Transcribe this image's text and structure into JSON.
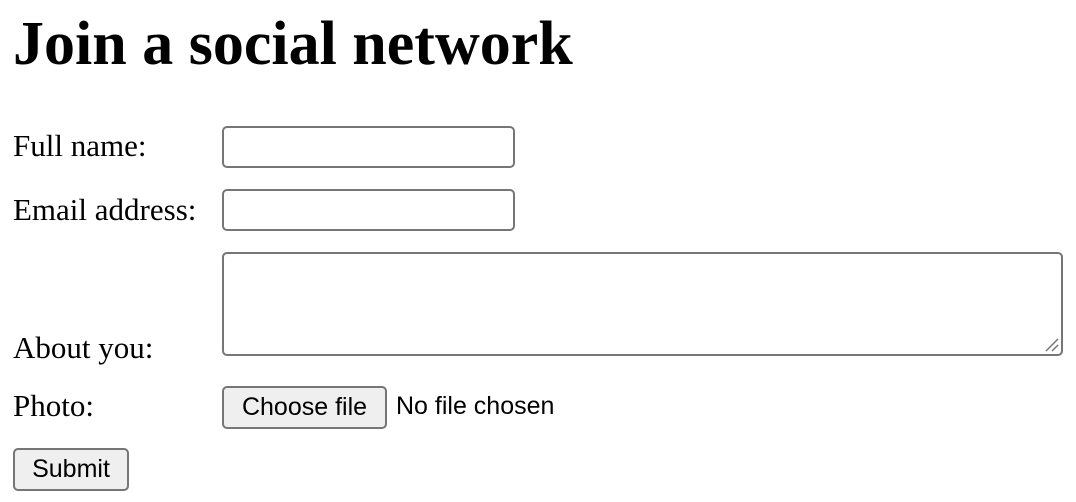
{
  "page": {
    "title": "Join a social network"
  },
  "form": {
    "full_name": {
      "label": "Full name:",
      "value": "",
      "placeholder": ""
    },
    "email": {
      "label": "Email address:",
      "value": "",
      "placeholder": ""
    },
    "about": {
      "label": "About you:",
      "value": ""
    },
    "photo": {
      "label": "Photo:",
      "button_label": "Choose file",
      "status": "No file chosen"
    },
    "submit_label": "Submit"
  },
  "colors": {
    "border": "#767676",
    "button_bg": "#efefef",
    "text": "#000000",
    "background": "#ffffff"
  },
  "icons": {
    "textarea_resize": "resize-grip-icon"
  }
}
